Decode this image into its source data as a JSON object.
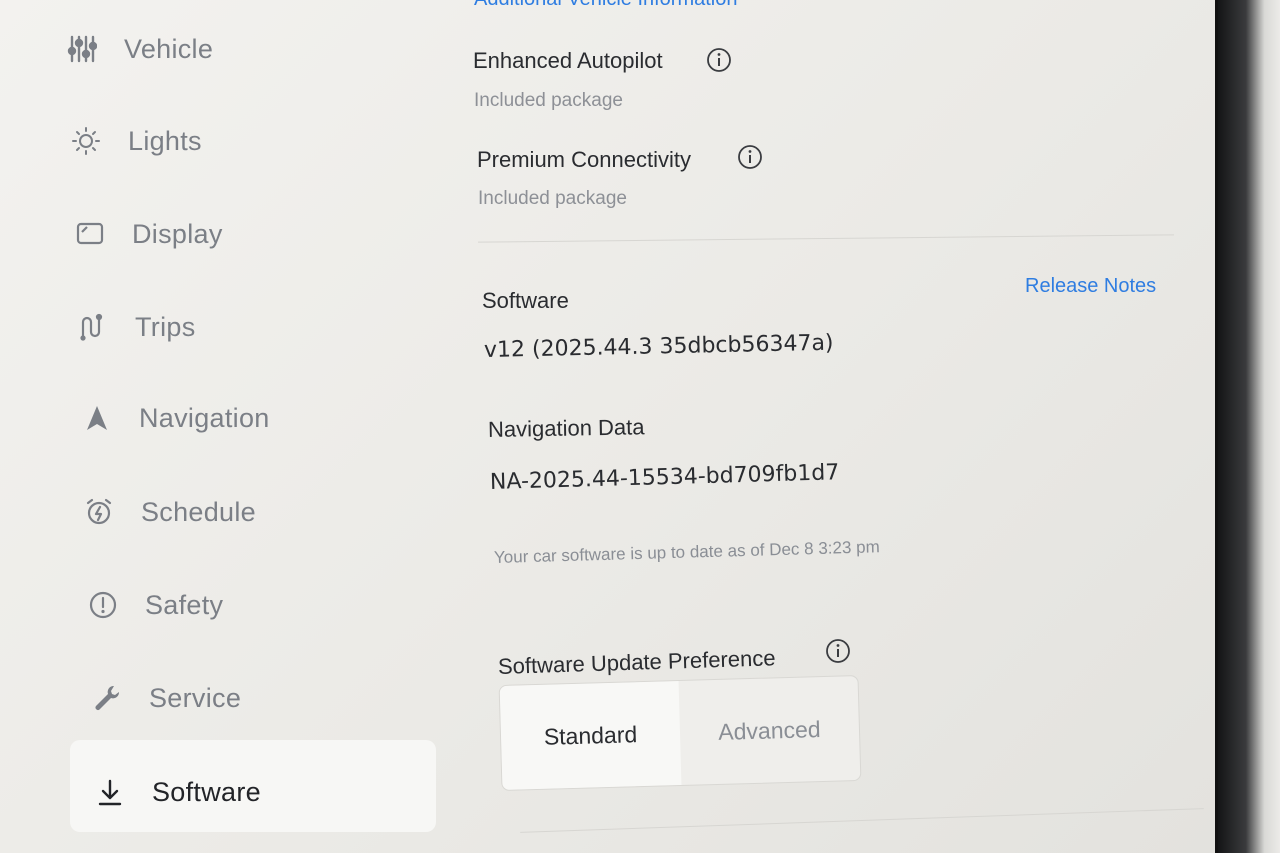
{
  "sidebar": {
    "items": [
      {
        "label": "Vehicle",
        "icon": "sliders-icon"
      },
      {
        "label": "Lights",
        "icon": "sun-icon"
      },
      {
        "label": "Display",
        "icon": "display-icon"
      },
      {
        "label": "Trips",
        "icon": "trips-icon"
      },
      {
        "label": "Navigation",
        "icon": "navigation-arrow-icon"
      },
      {
        "label": "Schedule",
        "icon": "alarm-clock-icon"
      },
      {
        "label": "Safety",
        "icon": "exclamation-circle-icon"
      },
      {
        "label": "Service",
        "icon": "wrench-icon"
      },
      {
        "label": "Software",
        "icon": "download-icon",
        "active": true
      }
    ]
  },
  "main": {
    "top_link": "Additional Vehicle Information",
    "packages": [
      {
        "title": "Enhanced Autopilot",
        "status": "Included package"
      },
      {
        "title": "Premium Connectivity",
        "status": "Included package"
      }
    ],
    "software": {
      "label": "Software",
      "version": "v12 (2025.44.3 35dbcb56347a)",
      "release_notes": "Release Notes"
    },
    "navigation_data": {
      "label": "Navigation Data",
      "value": "NA-2025.44-15534-bd709fb1d7"
    },
    "status_note": "Your car software is up to date as of Dec 8 3:23 pm",
    "update_preference": {
      "label": "Software Update Preference",
      "options": [
        "Standard",
        "Advanced"
      ],
      "selected": "Standard"
    }
  },
  "colors": {
    "accent": "#2f7de1",
    "text_primary": "#2a2c30",
    "text_secondary": "#8d9096",
    "screen_bg": "#f0efec"
  }
}
